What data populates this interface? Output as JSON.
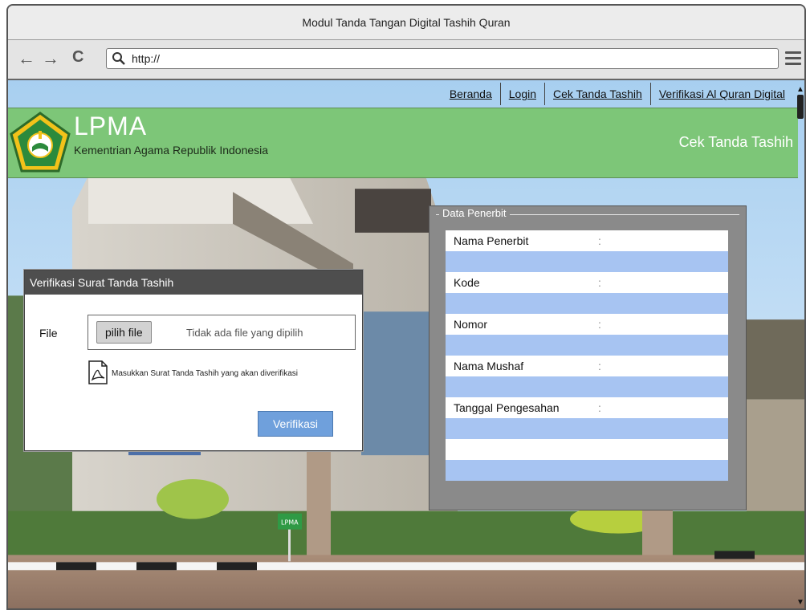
{
  "window": {
    "title": "Modul Tanda Tangan Digital Tashih Quran"
  },
  "toolbar": {
    "back": "←",
    "forward": "→",
    "reload": "C",
    "url": "http://"
  },
  "nav": {
    "items": [
      "Beranda",
      "Login",
      "Cek Tanda Tashih",
      "Verifikasi Al Quran Digital"
    ]
  },
  "header": {
    "brand": "LPMA",
    "subtitle": "Kementrian Agama Republik Indonesia",
    "page_title": "Cek Tanda Tashih"
  },
  "verifikasi": {
    "title": "Verifikasi Surat Tanda Tashih",
    "file_label": "File",
    "choose_button": "pilih file",
    "no_file": "Tidak ada file yang dipilih",
    "hint": "Masukkan Surat Tanda Tashih yang akan diverifikasi",
    "submit": "Verifikasi"
  },
  "penerbit": {
    "legend": "Data Penerbit",
    "fields": [
      {
        "label": "Nama Penerbit",
        "colon": ":"
      },
      {
        "label": "Kode",
        "colon": ":"
      },
      {
        "label": "Nomor",
        "colon": ":"
      },
      {
        "label": "Nama Mushaf",
        "colon": ":"
      },
      {
        "label": "Tanggal Pengesahan",
        "colon": ":"
      }
    ]
  },
  "background": {
    "sign_text": "LPMA"
  },
  "colors": {
    "header_green": "#78c46e",
    "button_blue": "#6fa0dc",
    "row_blue": "#a7c4f2",
    "dialog_header": "#4e4e4e"
  }
}
